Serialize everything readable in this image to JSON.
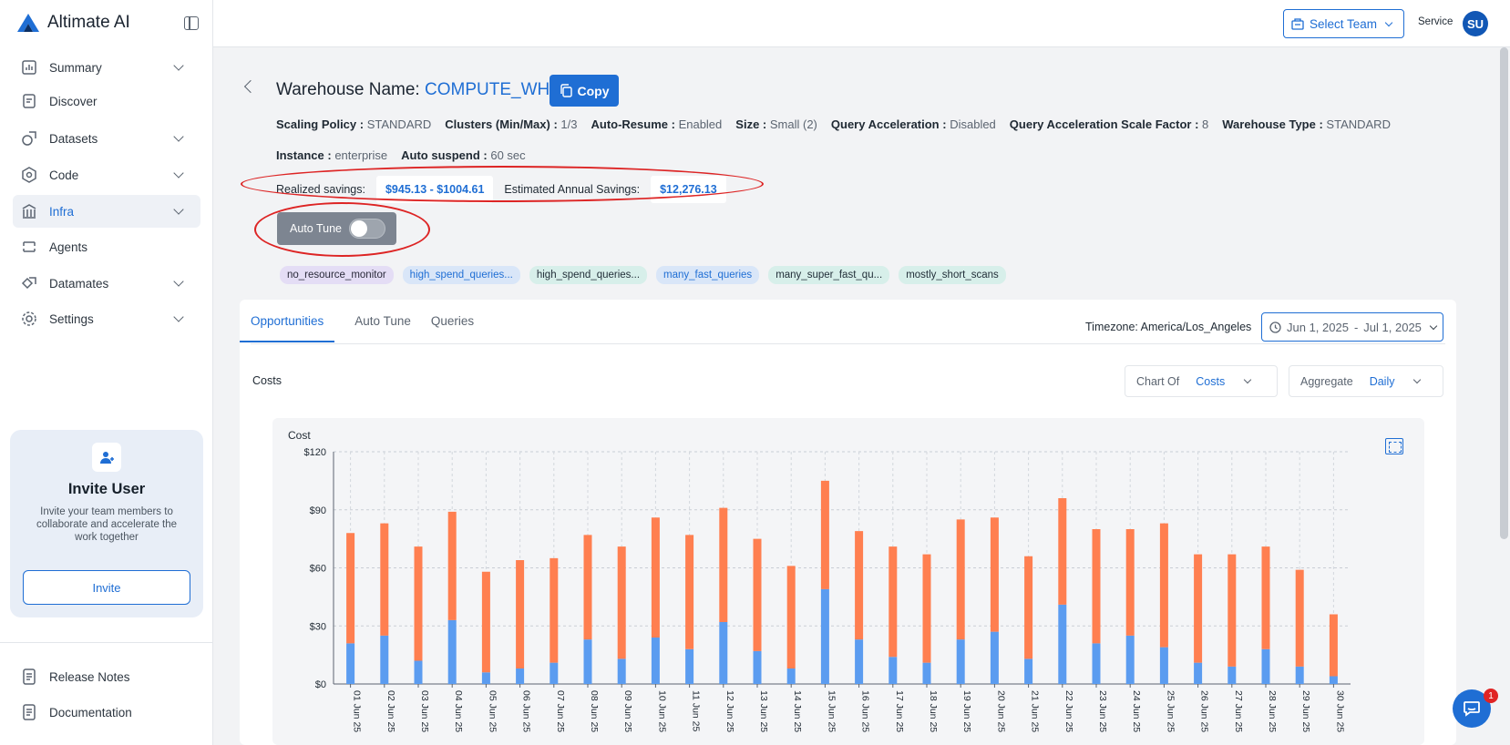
{
  "brand": {
    "name": "Altimate AI"
  },
  "sidebar": {
    "items": [
      {
        "label": "Summary",
        "has_chevron": true
      },
      {
        "label": "Discover",
        "has_chevron": false
      },
      {
        "label": "Datasets",
        "has_chevron": true
      },
      {
        "label": "Code",
        "has_chevron": true
      },
      {
        "label": "Infra",
        "has_chevron": true,
        "active": true
      },
      {
        "label": "Agents",
        "has_chevron": false
      },
      {
        "label": "Datamates",
        "has_chevron": true
      },
      {
        "label": "Settings",
        "has_chevron": true
      }
    ],
    "invite": {
      "title": "Invite User",
      "text": "Invite your team members to collaborate and accelerate the work together",
      "button": "Invite"
    },
    "footer": [
      "Release Notes",
      "Documentation"
    ]
  },
  "topbar": {
    "select_team": "Select Team",
    "service": "Service",
    "avatar_initials": "SU"
  },
  "warehouse": {
    "label": "Warehouse Name:",
    "name": "COMPUTE_WH",
    "copy_label": "Copy",
    "meta_row1": [
      {
        "key": "Scaling Policy :",
        "value": "STANDARD"
      },
      {
        "key": "Clusters (Min/Max) :",
        "value": "1/3"
      },
      {
        "key": "Auto-Resume :",
        "value": "Enabled"
      },
      {
        "key": "Size :",
        "value": "Small (2)"
      },
      {
        "key": "Query Acceleration :",
        "value": "Disabled"
      },
      {
        "key": "Query Acceleration Scale Factor :",
        "value": "8"
      },
      {
        "key": "Warehouse Type :",
        "value": "STANDARD"
      }
    ],
    "meta_row2": [
      {
        "key": "Instance :",
        "value": "enterprise"
      },
      {
        "key": "Auto suspend :",
        "value": "60 sec"
      }
    ],
    "savings": {
      "realized_label": "Realized savings:",
      "realized_value": "$945.13 - $1004.61",
      "annual_label": "Estimated Annual Savings:",
      "annual_value": "$12,276.13"
    },
    "auto_tune_label": "Auto Tune",
    "auto_tune_enabled": false,
    "tags": [
      {
        "label": "no_resource_monitor",
        "style": "purple"
      },
      {
        "label": "high_spend_queries...",
        "style": "blue"
      },
      {
        "label": "high_spend_queries...",
        "style": "teal"
      },
      {
        "label": "many_fast_queries",
        "style": "blue"
      },
      {
        "label": "many_super_fast_qu...",
        "style": "teal"
      },
      {
        "label": "mostly_short_scans",
        "style": "teal"
      }
    ]
  },
  "panel": {
    "tabs": [
      "Opportunities",
      "Auto Tune",
      "Queries"
    ],
    "active_tab": "Opportunities",
    "timezone": "Timezone: America/Los_Angeles",
    "date_from": "Jun 1, 2025",
    "date_sep": "-",
    "date_to": "Jul 1, 2025",
    "costs_label": "Costs",
    "chart_of_label": "Chart Of",
    "chart_of_value": "Costs",
    "aggregate_label": "Aggregate",
    "aggregate_value": "Daily"
  },
  "chat": {
    "badge": "1"
  },
  "colors": {
    "accent": "#1f6ed4",
    "bar_top": "#ff7f50",
    "bar_bottom": "#5b9cf0",
    "annotation": "#dd2424"
  },
  "chart_data": {
    "type": "bar",
    "stacked": true,
    "ylabel": "Cost",
    "y_ticks": [
      "$0",
      "$30",
      "$60",
      "$90",
      "$120"
    ],
    "ylim": [
      0,
      120
    ],
    "grid": true,
    "categories": [
      "01 Jun 25",
      "02 Jun 25",
      "03 Jun 25",
      "04 Jun 25",
      "05 Jun 25",
      "06 Jun 25",
      "07 Jun 25",
      "08 Jun 25",
      "09 Jun 25",
      "10 Jun 25",
      "11 Jun 25",
      "12 Jun 25",
      "13 Jun 25",
      "14 Jun 25",
      "15 Jun 25",
      "16 Jun 25",
      "17 Jun 25",
      "18 Jun 25",
      "19 Jun 25",
      "20 Jun 25",
      "21 Jun 25",
      "22 Jun 25",
      "23 Jun 25",
      "24 Jun 25",
      "25 Jun 25",
      "26 Jun 25",
      "27 Jun 25",
      "28 Jun 25",
      "29 Jun 25",
      "30 Jun 25"
    ],
    "series": [
      {
        "color": "#5b9cf0",
        "values": [
          21,
          25,
          12,
          33,
          6,
          8,
          11,
          23,
          13,
          24,
          18,
          32,
          17,
          8,
          49,
          23,
          14,
          11,
          23,
          27,
          13,
          41,
          21,
          25,
          19,
          11,
          9,
          18,
          9,
          4
        ]
      },
      {
        "color": "#ff7f50",
        "values": [
          57,
          58,
          59,
          56,
          52,
          56,
          54,
          54,
          58,
          62,
          59,
          59,
          58,
          53,
          56,
          56,
          57,
          56,
          62,
          59,
          53,
          55,
          59,
          55,
          64,
          56,
          58,
          53,
          50,
          32
        ]
      }
    ]
  }
}
